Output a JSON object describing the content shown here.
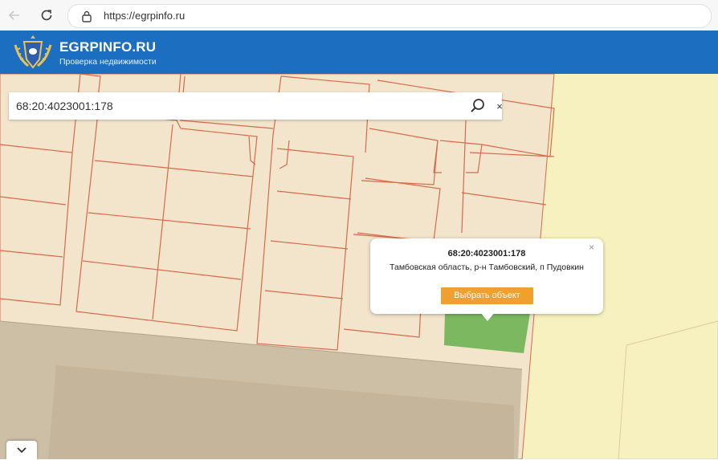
{
  "browser": {
    "url": "https://egrpinfo.ru",
    "back_icon": "arrow-left-icon",
    "reload_icon": "reload-icon",
    "site_info_icon": "site-info-icon"
  },
  "site": {
    "title": "EGRPINFO.RU",
    "subtitle": "Проверка недвижимости",
    "logo_icon": "emblem-icon",
    "header_color": "#1c6fc0"
  },
  "search": {
    "value": "68:20:4023001:178",
    "search_icon": "search-icon",
    "clear_label": "×"
  },
  "popup": {
    "title": "68:20:4023001:178",
    "address": "Тамбовская область, р-н Тамбовский, п Пудовкин",
    "button_label": "Выбрать объект",
    "close_label": "×",
    "button_color": "#f0a030"
  },
  "map": {
    "parcel_fill": "#f3e4cc",
    "parcel_border": "#d96a4a",
    "selected_parcel_fill": "#7cb860",
    "field_fill": "#f7f1bf",
    "road_fill": "#cdbfa6"
  },
  "panel_toggle_icon": "chevron-down-icon"
}
